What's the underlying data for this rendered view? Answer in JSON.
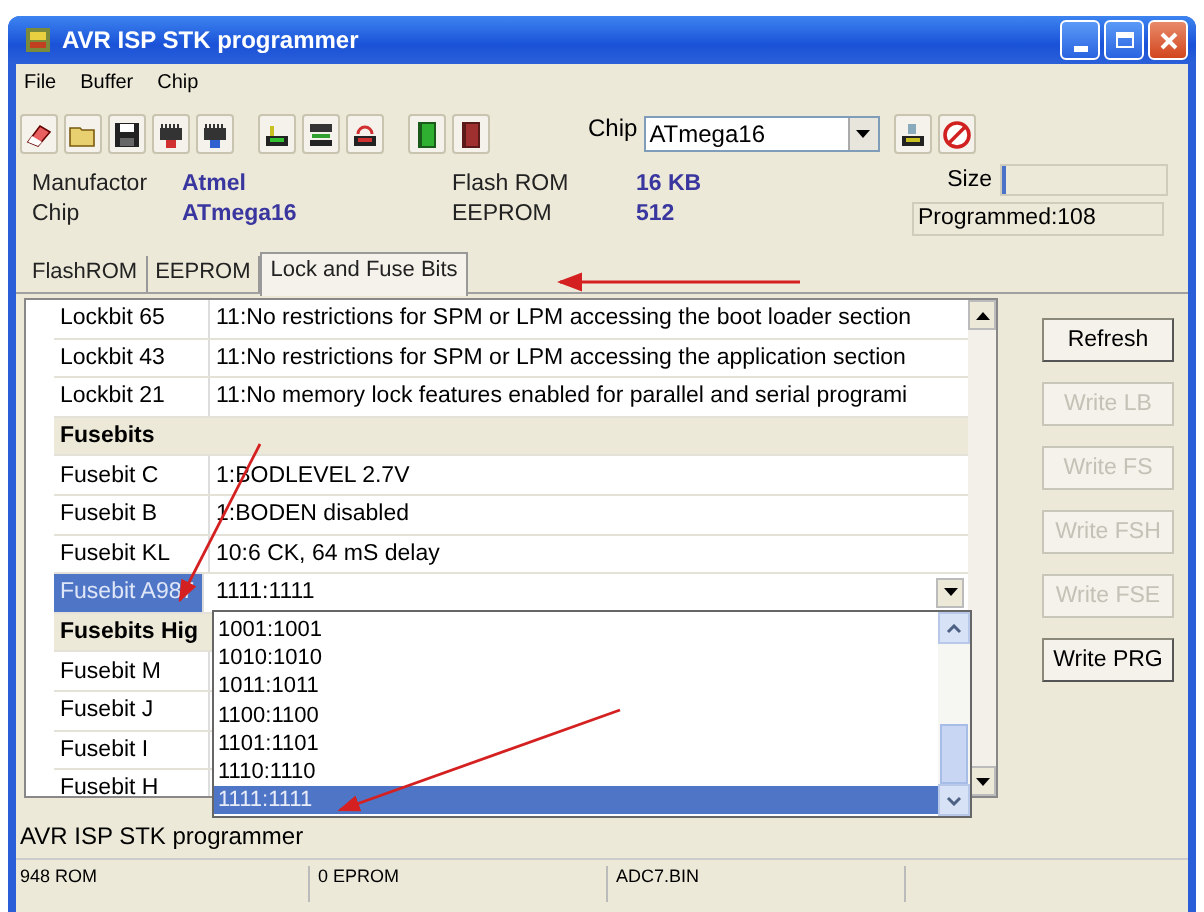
{
  "window": {
    "title": "AVR ISP STK programmer"
  },
  "menu": [
    "File",
    "Buffer",
    "Chip"
  ],
  "toolbar": {
    "chip_label": "Chip",
    "chip_value": "ATmega16"
  },
  "info": [
    {
      "label": "Manufactor",
      "value": "Atmel"
    },
    {
      "label": "Chip",
      "value": "ATmega16"
    },
    {
      "label": "Flash ROM",
      "value": "16 KB"
    },
    {
      "label": "EEPROM",
      "value": "512"
    }
  ],
  "size": {
    "label": "Size",
    "level": 0.03,
    "programmed": "Programmed:108"
  },
  "tabs": [
    {
      "label": "FlashROM",
      "selected": false
    },
    {
      "label": "EEPROM",
      "selected": false
    },
    {
      "label": "Lock and Fuse Bits",
      "selected": true
    }
  ],
  "grid": {
    "rows": [
      {
        "kind": "row",
        "label": "Lockbit 65",
        "value": "11:No restrictions for SPM or LPM accessing the boot loader section",
        "selected": false
      },
      {
        "kind": "row",
        "label": "Lockbit 43",
        "value": "11:No restrictions for SPM or LPM accessing the application section",
        "selected": false
      },
      {
        "kind": "row",
        "label": "Lockbit 21",
        "value": "11:No memory lock features enabled for parallel and serial programi",
        "selected": false
      },
      {
        "kind": "header",
        "label": "Fusebits"
      },
      {
        "kind": "row",
        "label": "Fusebit C",
        "value": "1:BODLEVEL 2.7V",
        "selected": false
      },
      {
        "kind": "row",
        "label": "Fusebit B",
        "value": "1:BODEN disabled",
        "selected": false
      },
      {
        "kind": "row",
        "label": "Fusebit KL",
        "value": "10:6 CK, 64 mS delay",
        "selected": false
      },
      {
        "kind": "combo",
        "label": "Fusebit A987",
        "value": "1111:1111",
        "selected": true
      },
      {
        "kind": "header",
        "label": "Fusebits Hig"
      },
      {
        "kind": "row",
        "label": "Fusebit M",
        "value": "",
        "selected": false
      },
      {
        "kind": "row",
        "label": "Fusebit J",
        "value": "",
        "selected": false
      },
      {
        "kind": "row",
        "label": "Fusebit I",
        "value": "",
        "selected": false
      },
      {
        "kind": "row",
        "label": "Fusebit H",
        "value": "",
        "selected": false
      }
    ]
  },
  "dropdown": {
    "options": [
      {
        "label": "1001:1001",
        "selected": false
      },
      {
        "label": "1010:1010",
        "selected": false
      },
      {
        "label": "1011:1011",
        "selected": false
      },
      {
        "label": "1100:1100",
        "selected": false
      },
      {
        "label": "1101:1101",
        "selected": false
      },
      {
        "label": "1110:1110",
        "selected": false
      },
      {
        "label": "1111:1111",
        "selected": true
      }
    ]
  },
  "buttons": [
    {
      "label": "Refresh",
      "disabled": false
    },
    {
      "label": "Write LB",
      "disabled": true
    },
    {
      "label": "Write FS",
      "disabled": true
    },
    {
      "label": "Write FSH",
      "disabled": true
    },
    {
      "label": "Write FSE",
      "disabled": true
    },
    {
      "label": "Write PRG",
      "disabled": false
    }
  ],
  "status_text": "AVR ISP STK programmer",
  "status_bar": [
    "948 ROM",
    "0 EPROM",
    "ADC7.BIN"
  ]
}
